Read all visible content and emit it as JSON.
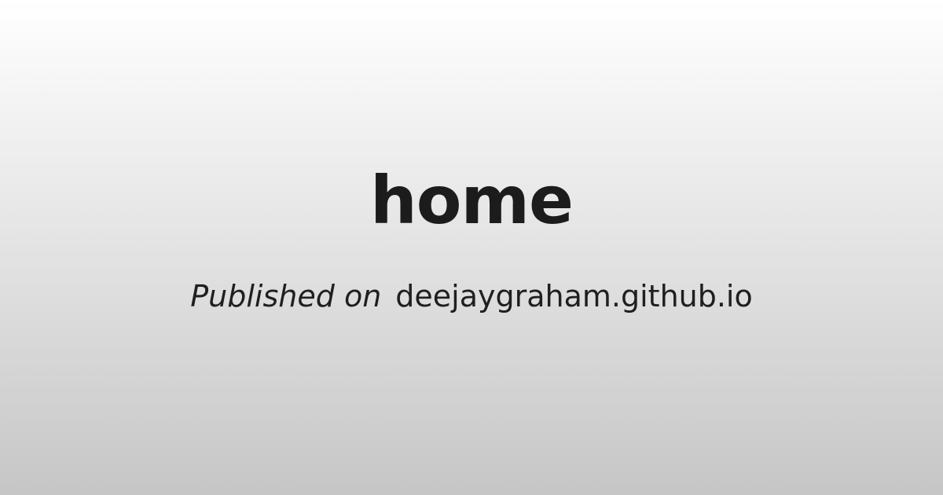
{
  "card": {
    "title": "home",
    "byline": {
      "prefix": "Published on",
      "domain": "deejaygraham.github.io"
    }
  },
  "colors": {
    "gradient_top": "#ffffff",
    "gradient_bottom": "#c6c6c6",
    "text": "#1f1f1f"
  }
}
